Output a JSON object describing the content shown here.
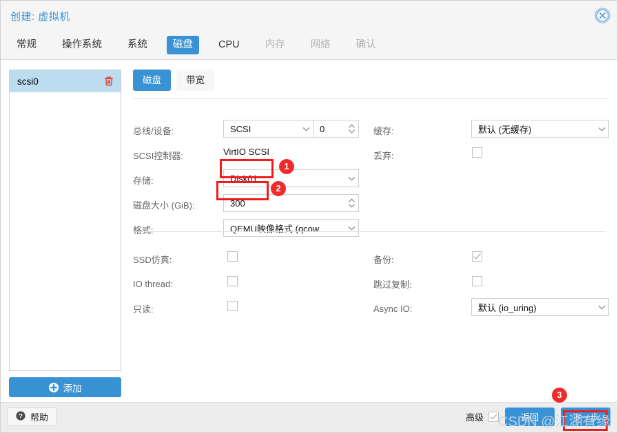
{
  "window": {
    "title": "创建: 虚拟机",
    "close_icon": "close-circle-icon",
    "accent_color": "#3892d4",
    "annotation_color": "#f02b2b"
  },
  "tabs": [
    {
      "label": "常规",
      "state": "enabled"
    },
    {
      "label": "操作系统",
      "state": "enabled"
    },
    {
      "label": "系统",
      "state": "enabled"
    },
    {
      "label": "磁盘",
      "state": "active"
    },
    {
      "label": "CPU",
      "state": "enabled"
    },
    {
      "label": "内存",
      "state": "disabled"
    },
    {
      "label": "网络",
      "state": "disabled"
    },
    {
      "label": "确认",
      "state": "disabled"
    }
  ],
  "device_list": {
    "items": [
      {
        "name": "scsi0",
        "selected": true,
        "delete_icon": "trash-icon"
      }
    ],
    "add_button": {
      "label": "添加",
      "icon": "plus-circle-icon"
    }
  },
  "subtabs": [
    {
      "label": "磁盘",
      "state": "active"
    },
    {
      "label": "带宽",
      "state": "enabled"
    }
  ],
  "form": {
    "bus_device": {
      "label": "总线/设备:",
      "bus_value": "SCSI",
      "device_value": "0"
    },
    "scsi_controller": {
      "label": "SCSI控制器:",
      "value": "VirtIO SCSI"
    },
    "storage": {
      "label": "存储:",
      "value": "Disk01"
    },
    "disk_size": {
      "label": "磁盘大小 (GiB):",
      "value": "300"
    },
    "format": {
      "label": "格式:",
      "value": "QEMU映像格式 (qcow"
    },
    "cache": {
      "label": "缓存:",
      "value": "默认 (无缓存)"
    },
    "discard": {
      "label": "丢弃:",
      "checked": false
    },
    "ssd_emulation": {
      "label": "SSD仿真:",
      "checked": false
    },
    "io_thread": {
      "label": "IO thread:",
      "checked": false
    },
    "readonly": {
      "label": "只读:",
      "checked": false
    },
    "backup": {
      "label": "备份:",
      "checked": true
    },
    "skip_replication": {
      "label": "跳过复制:",
      "checked": false
    },
    "async_io": {
      "label": "Async IO:",
      "value": "默认 (io_uring)"
    }
  },
  "footer": {
    "help": {
      "label": "帮助",
      "icon": "help-circle-icon"
    },
    "advanced": {
      "label": "高级",
      "checked": true
    },
    "back_button": "返回",
    "next_button": "下一步"
  },
  "annotations": [
    {
      "badge": "1",
      "target": "storage-field"
    },
    {
      "badge": "2",
      "target": "disk-size-field"
    },
    {
      "badge": "3",
      "target": "next-button"
    }
  ],
  "watermark": {
    "text": "CSDN @江湖有缘"
  }
}
